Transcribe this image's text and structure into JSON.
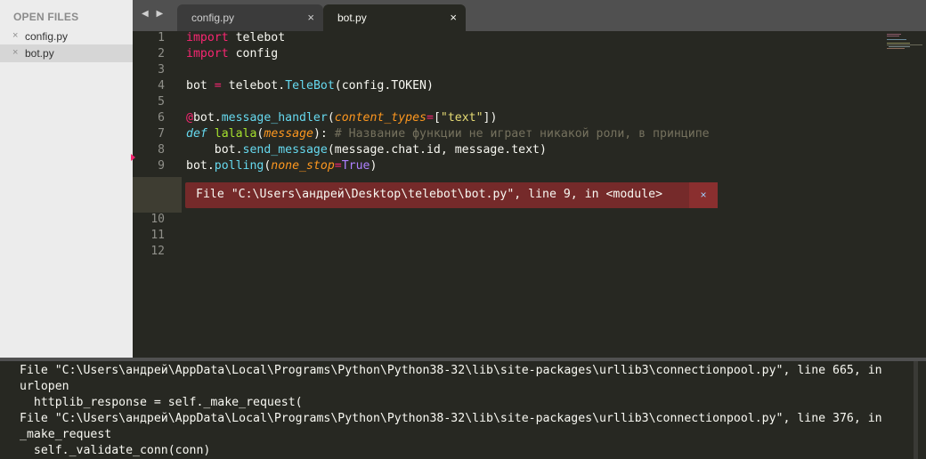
{
  "sidebar": {
    "title": "OPEN FILES",
    "files": [
      {
        "name": "config.py",
        "close": "×"
      },
      {
        "name": "bot.py",
        "close": "×"
      }
    ]
  },
  "tabbar": {
    "nav": "◀ ▶",
    "tabs": [
      {
        "label": "config.py",
        "close": "×"
      },
      {
        "label": "bot.py",
        "close": "×"
      }
    ]
  },
  "editor": {
    "line_numbers": [
      "1",
      "2",
      "3",
      "4",
      "5",
      "6",
      "7",
      "8",
      "9",
      "10",
      "11",
      "12"
    ],
    "line2": {
      "kw": "import",
      "rest": " config"
    },
    "line1": {
      "kw": "import",
      "rest": " telebot"
    },
    "line4": {
      "a": "bot ",
      "eq": "=",
      "b": " telebot.",
      "cls": "TeleBot",
      "c": "(config.TOKEN)"
    },
    "line6": {
      "at": "@",
      "a": "bot.",
      "fn": "message_handler",
      "b": "(",
      "param": "content_types",
      "eq": "=",
      "c": "[",
      "str": "\"text\"",
      "d": "])"
    },
    "line7": {
      "def": "def",
      "sp": " ",
      "name": "lalala",
      "a": "(",
      "param": "message",
      "b": "): ",
      "cmt": "# Название функции не играет никакой роли, в принципе"
    },
    "line8": {
      "a": "    bot.",
      "fn": "send_message",
      "b": "(message.chat.id, message.text)"
    },
    "line9": {
      "a": "bot.",
      "fn": "polling",
      "b": "(",
      "param": "none_stop",
      "eq": "=",
      "const": "True",
      "c": ")"
    },
    "error": {
      "message": "File \"C:\\Users\\андрей\\Desktop\\telebot\\bot.py\", line 9, in <module>",
      "close": "×"
    }
  },
  "output": {
    "lines": [
      "File \"C:\\Users\\андрей\\AppData\\Local\\Programs\\Python\\Python38-32\\lib\\site-packages\\urllib3\\connectionpool.py\", line 665, in",
      "urlopen",
      "  httplib_response = self._make_request(",
      "File \"C:\\Users\\андрей\\AppData\\Local\\Programs\\Python\\Python38-32\\lib\\site-packages\\urllib3\\connectionpool.py\", line 376, in",
      "_make_request",
      "  self._validate_conn(conn)"
    ]
  },
  "colors": {
    "editor_bg": "#272822",
    "keyword": "#f92672",
    "function": "#66d9ef",
    "string": "#e6db74",
    "comment": "#75715e",
    "parameter": "#fd971f",
    "constant": "#ae81ff",
    "error_bg": "#752a2a"
  }
}
